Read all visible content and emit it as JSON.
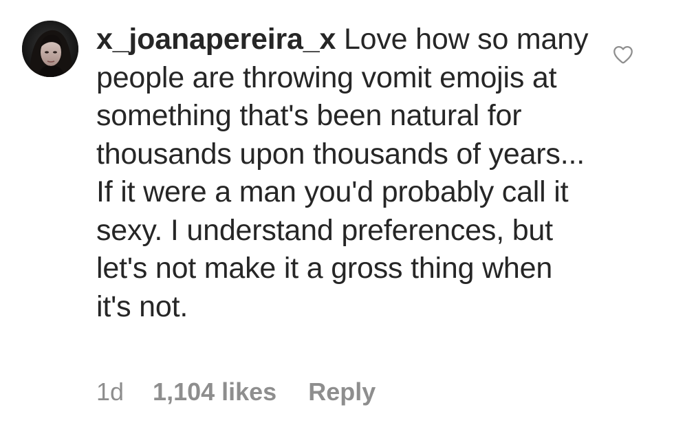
{
  "comment": {
    "username": "x_joanapereira_x",
    "text": "Love how so many people are throwing vomit emojis at something that's been natural for thousands upon thousands of years... If it were a man you'd probably call it sexy. I understand preferences, but let's not make it a gross thing when it's not.",
    "time": "1d",
    "likes": "1,104 likes",
    "reply_label": "Reply",
    "like_icon": "heart-outline-icon"
  },
  "colors": {
    "text": "#262626",
    "meta": "#8e8e8e",
    "icon": "#8e8e8e",
    "background": "#ffffff"
  }
}
